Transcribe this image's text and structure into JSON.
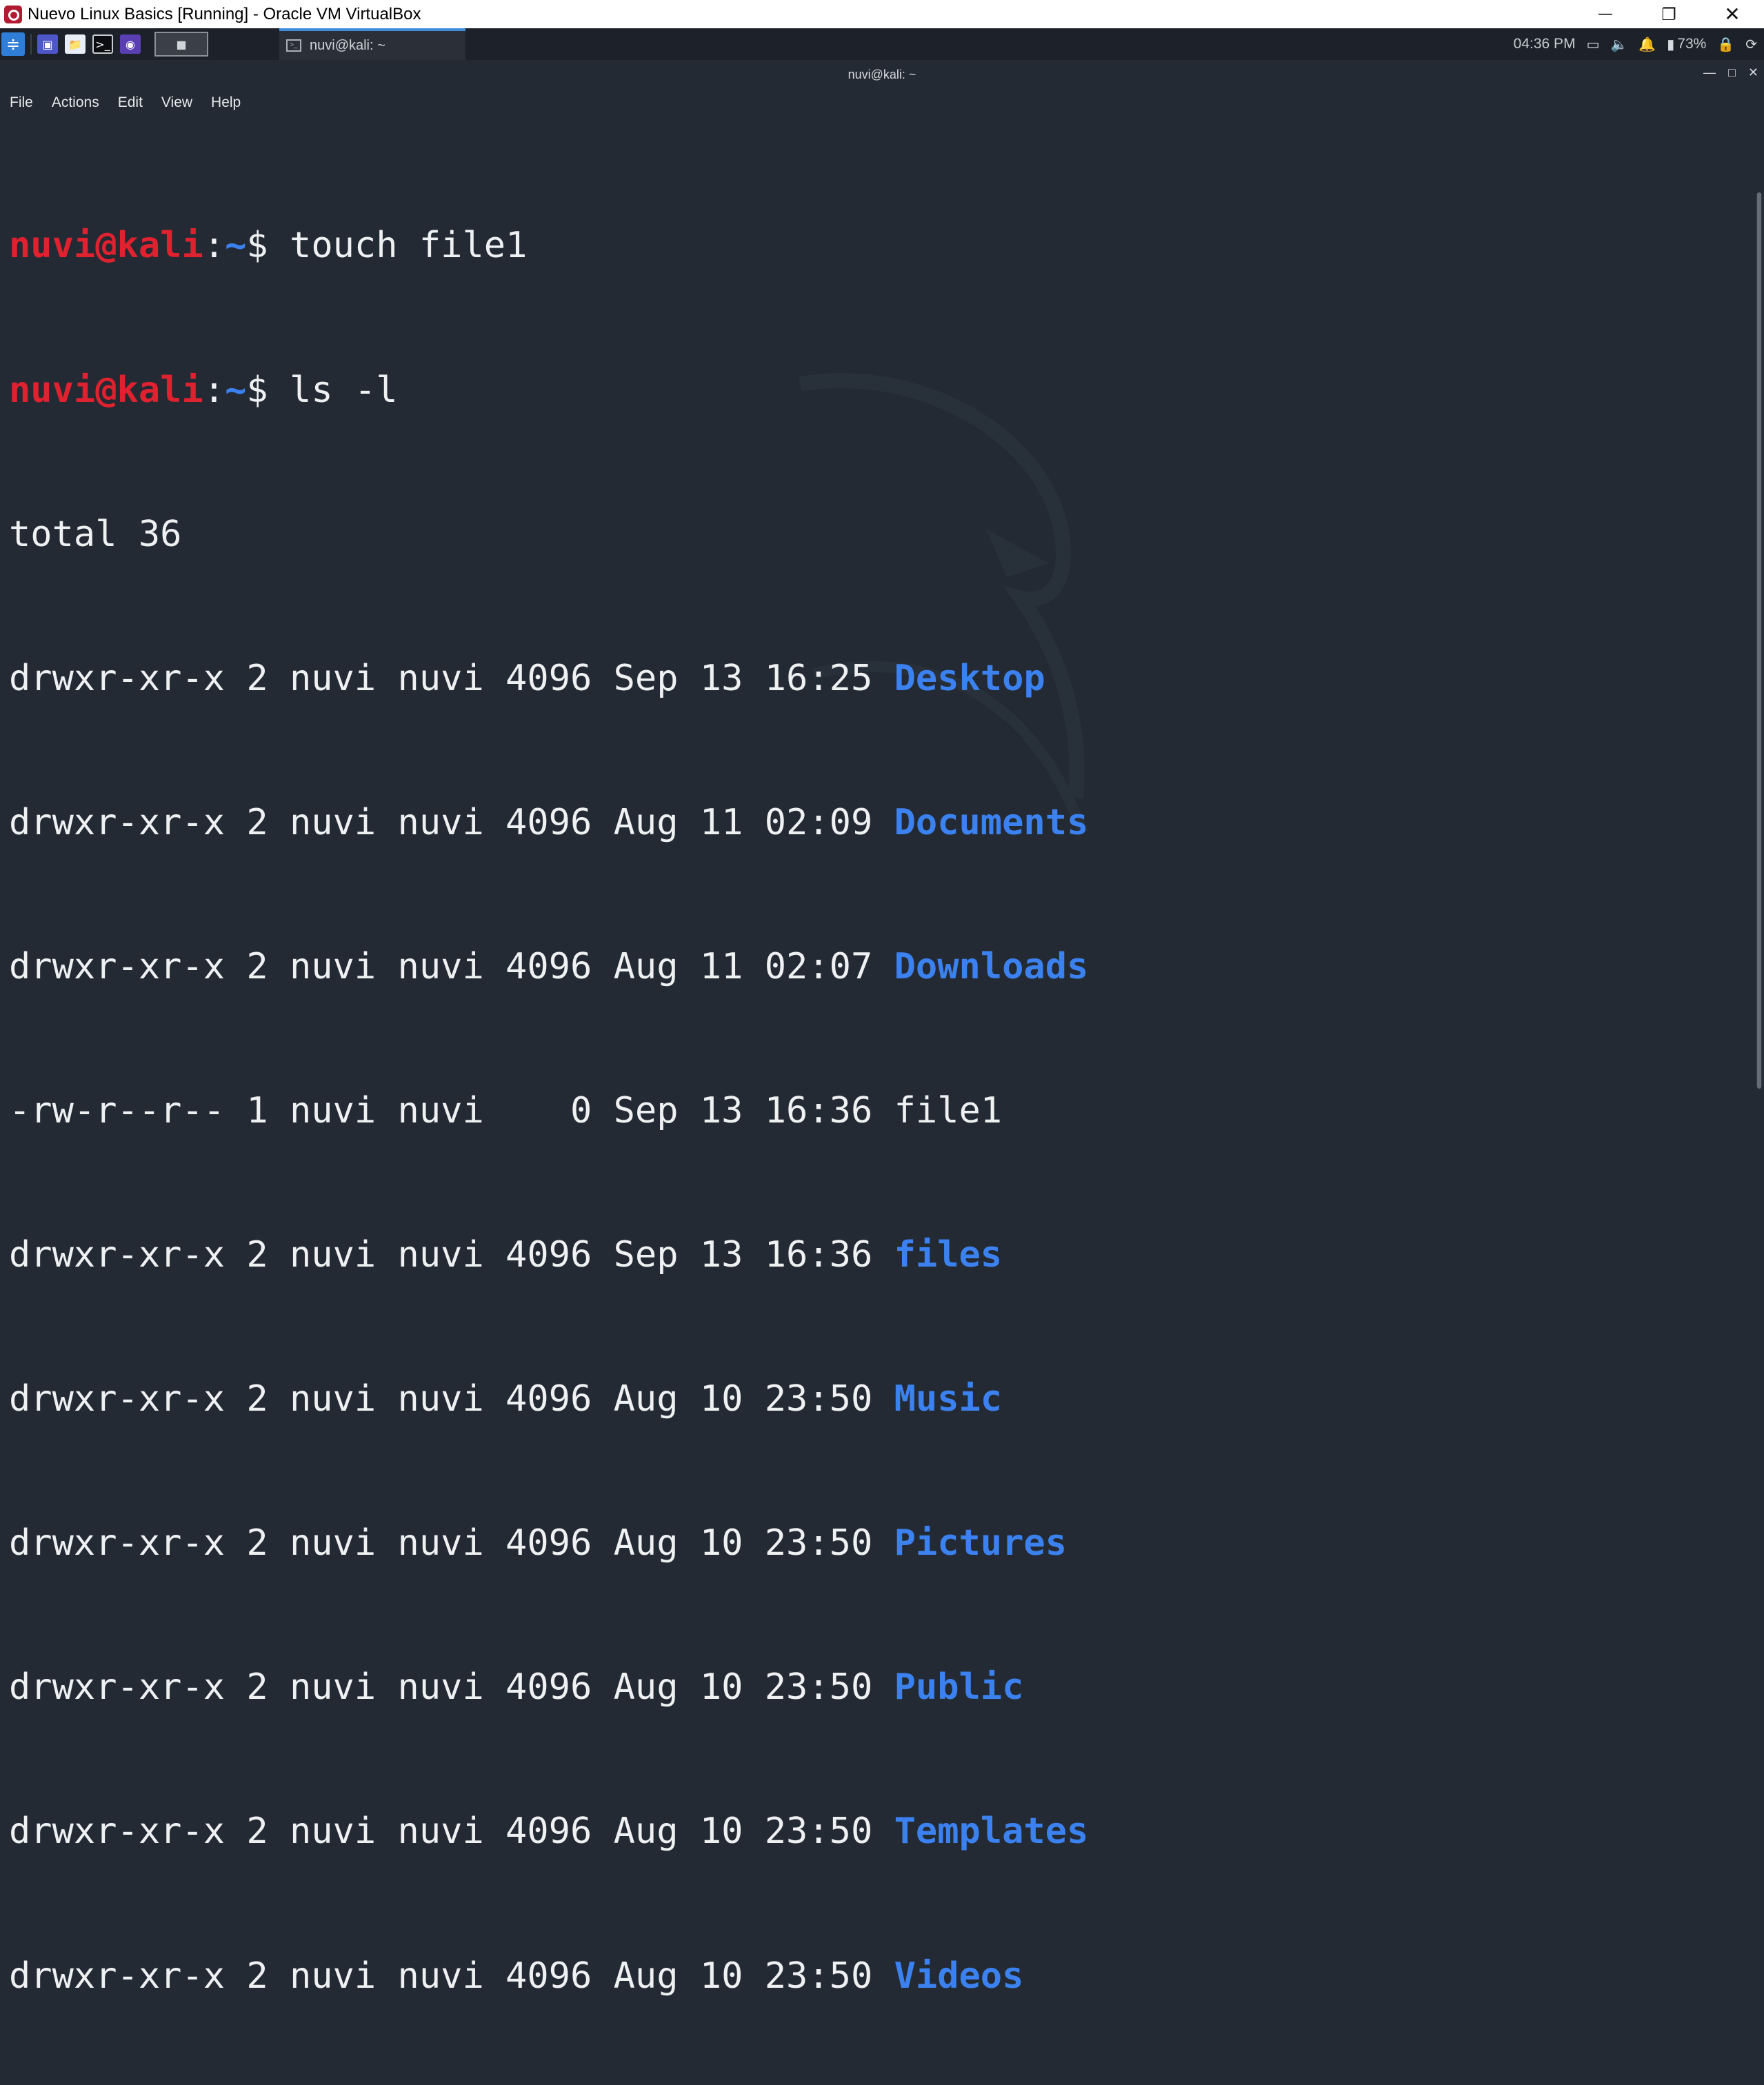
{
  "window": {
    "title": "Nuevo Linux Basics [Running] - Oracle VM VirtualBox",
    "minimize": "—",
    "restore": "❐",
    "close": "✕"
  },
  "panel": {
    "task_label": "nuvi@kali: ~",
    "time": "04:36 PM",
    "battery": "73%",
    "icons": [
      "kali-menu-icon",
      "desktop-icon",
      "files-icon",
      "terminal-icon",
      "screenshot-icon",
      "workspace-icon",
      "display-icon",
      "volume-icon",
      "bell-icon",
      "battery-icon",
      "lock-icon",
      "power-icon"
    ]
  },
  "terminal": {
    "title": "nuvi@kali: ~",
    "menu": [
      "File",
      "Actions",
      "Edit",
      "View",
      "Help"
    ],
    "prompt": {
      "user": "nuvi@kali",
      "colon": ":",
      "path": "~",
      "dollar": "$"
    },
    "commands": [
      "touch file1",
      "ls -l"
    ],
    "total": "total 36",
    "listing": [
      {
        "meta": "drwxr-xr-x 2 nuvi nuvi 4096 Sep 13 16:25 ",
        "name": "Desktop",
        "type": "dir"
      },
      {
        "meta": "drwxr-xr-x 2 nuvi nuvi 4096 Aug 11 02:09 ",
        "name": "Documents",
        "type": "dir"
      },
      {
        "meta": "drwxr-xr-x 2 nuvi nuvi 4096 Aug 11 02:07 ",
        "name": "Downloads",
        "type": "dir"
      },
      {
        "meta": "-rw-r--r-- 1 nuvi nuvi    0 Sep 13 16:36 ",
        "name": "file1",
        "type": "file"
      },
      {
        "meta": "drwxr-xr-x 2 nuvi nuvi 4096 Sep 13 16:36 ",
        "name": "files",
        "type": "dir"
      },
      {
        "meta": "drwxr-xr-x 2 nuvi nuvi 4096 Aug 10 23:50 ",
        "name": "Music",
        "type": "dir"
      },
      {
        "meta": "drwxr-xr-x 2 nuvi nuvi 4096 Aug 10 23:50 ",
        "name": "Pictures",
        "type": "dir"
      },
      {
        "meta": "drwxr-xr-x 2 nuvi nuvi 4096 Aug 10 23:50 ",
        "name": "Public",
        "type": "dir"
      },
      {
        "meta": "drwxr-xr-x 2 nuvi nuvi 4096 Aug 10 23:50 ",
        "name": "Templates",
        "type": "dir"
      },
      {
        "meta": "drwxr-xr-x 2 nuvi nuvi 4096 Aug 10 23:50 ",
        "name": "Videos",
        "type": "dir"
      }
    ]
  },
  "colors": {
    "background": "#232a33",
    "prompt_user": "#e0212f",
    "directory": "#3b82f0",
    "text": "#eef0f2"
  }
}
